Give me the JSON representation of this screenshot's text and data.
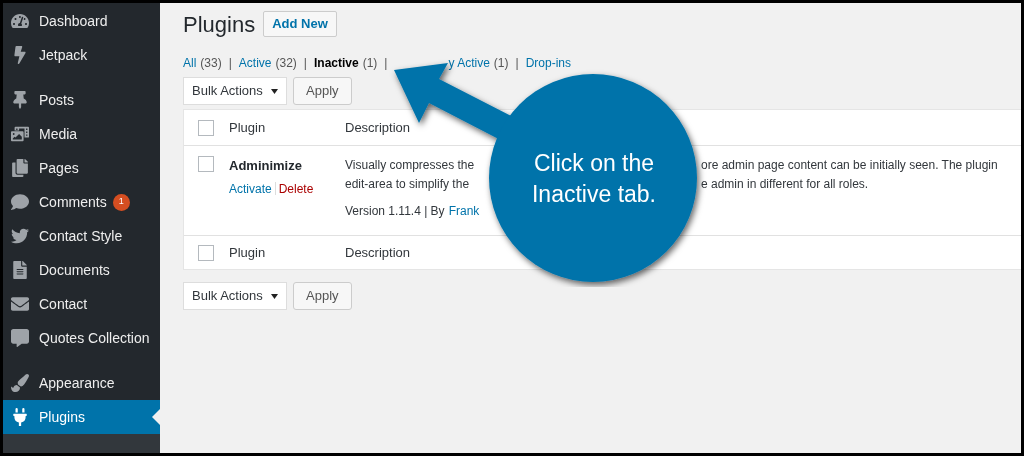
{
  "sidebar": {
    "groups": [
      {
        "items": [
          {
            "label": "Dashboard",
            "selected": false
          },
          {
            "label": "Jetpack",
            "selected": false
          }
        ]
      },
      {
        "items": [
          {
            "label": "Posts",
            "selected": false
          },
          {
            "label": "Media",
            "selected": false
          },
          {
            "label": "Pages",
            "selected": false
          },
          {
            "label": "Comments",
            "selected": false,
            "badge": "1"
          },
          {
            "label": "Contact Style",
            "selected": false
          },
          {
            "label": "Documents",
            "selected": false
          },
          {
            "label": "Contact",
            "selected": false
          },
          {
            "label": "Quotes Collection",
            "selected": false
          }
        ]
      },
      {
        "items": [
          {
            "label": "Appearance",
            "selected": false
          },
          {
            "label": "Plugins",
            "selected": true
          }
        ]
      }
    ]
  },
  "page": {
    "title": "Plugins",
    "add_button": "Add New"
  },
  "filters": [
    {
      "fragments": [
        "All"
      ],
      "count": "(33)",
      "selected": false
    },
    {
      "separator": "|",
      "fragments": [
        "Active"
      ],
      "count": "(32)",
      "selected": false
    },
    {
      "separator": "|",
      "fragments": [
        "Inactive"
      ],
      "count": "(1)",
      "selected": true
    },
    {
      "separator": "|",
      "fragments": [
        "y Active"
      ],
      "count": "(1)",
      "selected": false
    },
    {
      "separator": "|",
      "fragments": [
        "Drop-ins"
      ],
      "selected": false
    }
  ],
  "bulk_top": {
    "select": "Bulk Actions",
    "apply": "Apply"
  },
  "table": {
    "columns": [
      "Plugin",
      "Description"
    ],
    "header_checked": false,
    "footer_checked": false,
    "rows": [
      {
        "name": "Adminimize",
        "checked": false,
        "actions": [
          "Activate",
          "Delete"
        ],
        "description_lines": [
          [
            "Visually compresses the",
            "ore admin page content can be initially seen. The plugin"
          ],
          [
            "edit-area to simplify the",
            "e admin in different for all roles."
          ]
        ],
        "version": "Version 1.11.4 | By",
        "author": "Frank"
      }
    ],
    "footer_columns": [
      "Plugin",
      "Description"
    ]
  },
  "bulk_bottom": {
    "select": "Bulk Actions",
    "apply": "Apply"
  },
  "callout": {
    "text": "Click on the Inactive tab."
  }
}
